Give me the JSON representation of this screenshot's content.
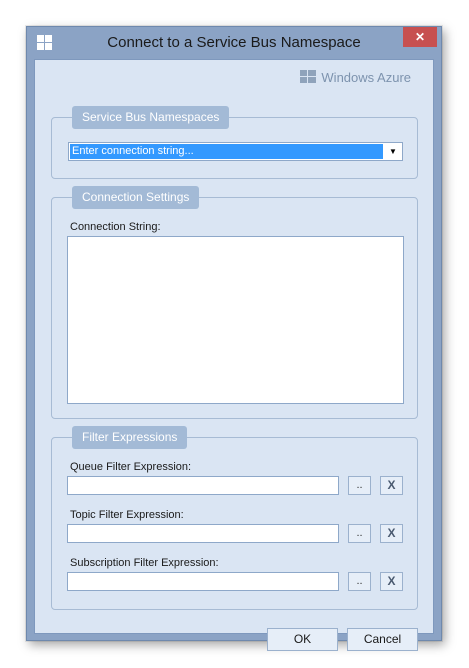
{
  "window": {
    "title": "Connect to a Service Bus Namespace",
    "close_glyph": "✕"
  },
  "brand": {
    "text": "Windows Azure"
  },
  "namespaces_group": {
    "header": "Service Bus Namespaces",
    "combo_value": "Enter connection string...",
    "combo_arrow": "▼"
  },
  "connection_group": {
    "header": "Connection Settings",
    "connection_string_label": "Connection String:",
    "connection_string_value": ""
  },
  "filter_group": {
    "header": "Filter Expressions",
    "rows": [
      {
        "label": "Queue Filter Expression:",
        "value": "",
        "browse": "..",
        "clear": "X"
      },
      {
        "label": "Topic Filter Expression:",
        "value": "",
        "browse": "..",
        "clear": "X"
      },
      {
        "label": "Subscription Filter Expression:",
        "value": "",
        "browse": "..",
        "clear": "X"
      }
    ]
  },
  "buttons": {
    "ok": "OK",
    "cancel": "Cancel"
  },
  "colors": {
    "title_bar": "#8ba3c5",
    "client_bg": "#dae5f3",
    "group_header": "#a3bad6",
    "selection": "#3399ff",
    "close_button": "#c75050"
  }
}
